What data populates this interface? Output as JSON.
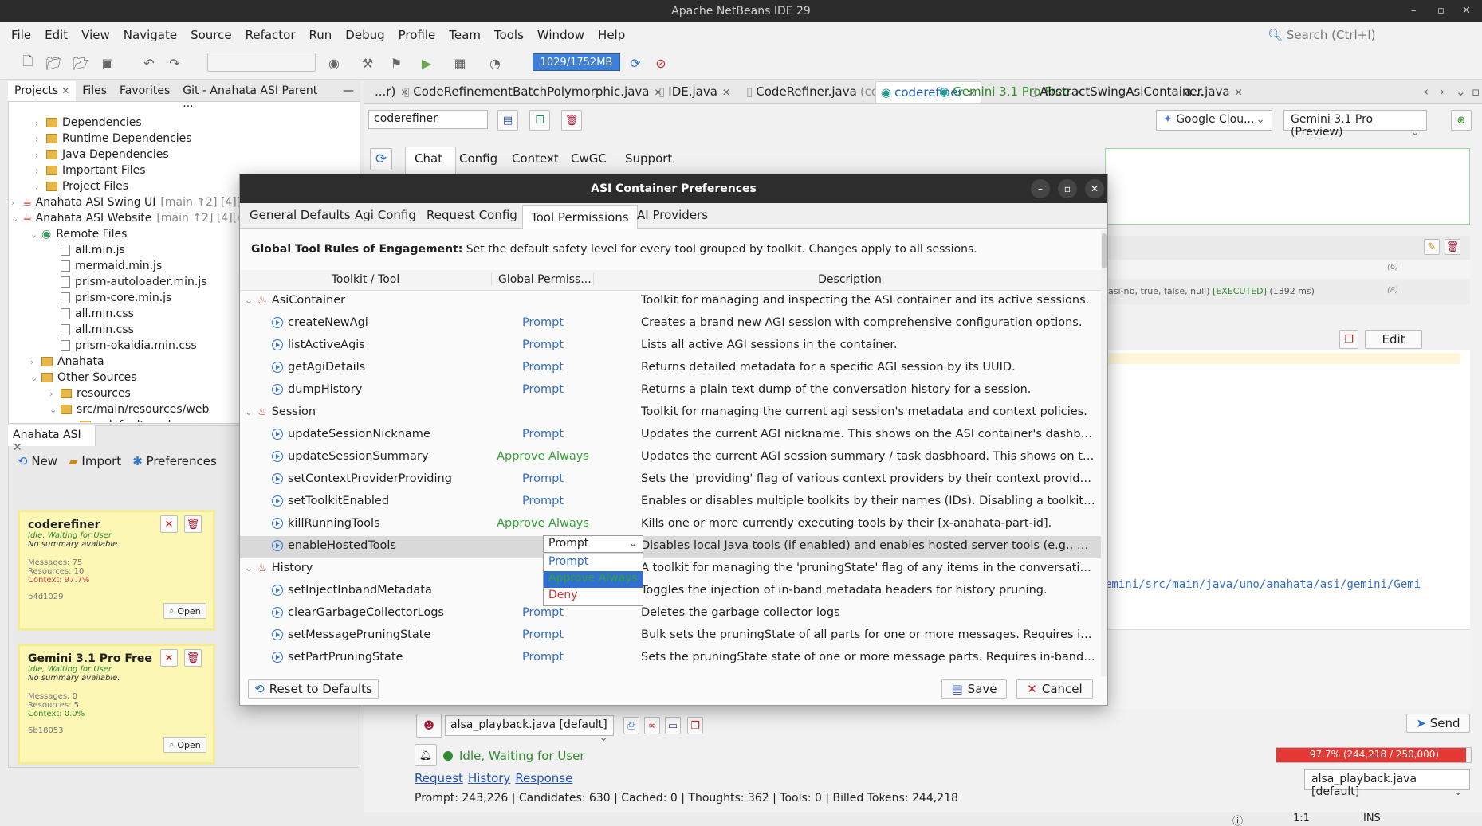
{
  "window": {
    "title": "Apache NetBeans IDE 29"
  },
  "menu": [
    "File",
    "Edit",
    "View",
    "Navigate",
    "Source",
    "Refactor",
    "Run",
    "Debug",
    "Profile",
    "Team",
    "Tools",
    "Window",
    "Help"
  ],
  "search": {
    "placeholder": "Search (Ctrl+I)"
  },
  "toolbar": {
    "memory": "1029/1752MB"
  },
  "left_tabs": [
    "Projects",
    "Files",
    "Favorites",
    "Git - Anahata ASI Parent ..."
  ],
  "tree": [
    {
      "label": "Dependencies"
    },
    {
      "label": "Runtime Dependencies"
    },
    {
      "label": "Java Dependencies"
    },
    {
      "label": "Important Files"
    },
    {
      "label": "Project Files"
    },
    {
      "label": "Anahata ASI Swing UI",
      "meta": "[main ↑2] [4][4]"
    },
    {
      "label": "Anahata ASI Website",
      "meta": "[main ↑2] [4][4]"
    },
    {
      "label": "Remote Files"
    },
    {
      "label": "all.min.js"
    },
    {
      "label": "mermaid.min.js"
    },
    {
      "label": "prism-autoloader.min.js"
    },
    {
      "label": "prism-core.min.js"
    },
    {
      "label": "all.min.css"
    },
    {
      "label": "all.min.css"
    },
    {
      "label": "prism-okaidia.min.css"
    },
    {
      "label": "Anahata"
    },
    {
      "label": "Other Sources"
    },
    {
      "label": "resources"
    },
    {
      "label": "src/main/resources/web"
    },
    {
      "label": "<default package>"
    }
  ],
  "asi_panel": {
    "tab": "Anahata ASI",
    "actions": {
      "new": "New",
      "import": "Import",
      "preferences": "Preferences"
    },
    "cards": [
      {
        "name": "coderefiner",
        "status": "Idle, Waiting for User",
        "summary": "No summary available.",
        "messages": "Messages: 75",
        "resources": "Resources: 10",
        "context": "Context: 97.7%",
        "id": "b4d1029",
        "open": "Open"
      },
      {
        "name": "Gemini 3.1 Pro Free",
        "status": "Idle, Waiting for User",
        "summary": "No summary available.",
        "messages": "Messages: 0",
        "resources": "Resources: 5",
        "context": "Context: 0.0%",
        "id": "6b18053",
        "open": "Open"
      }
    ]
  },
  "editor_tabs": [
    {
      "label": "...r)"
    },
    {
      "label": "CodeRefinementBatchPolymorphic.java"
    },
    {
      "label": "IDE.java"
    },
    {
      "label": "CodeRefiner.java",
      "meta": "(coderefiner)"
    },
    {
      "label": "coderefiner"
    },
    {
      "label": "Gemini 3.1 Pro Free"
    },
    {
      "label": "AbstractSwingAsiContainer.java"
    },
    {
      "label": "a..."
    }
  ],
  "agi_view": {
    "nickname": "coderefiner",
    "provider": "Google Clou...",
    "model": "Gemini 3.1 Pro (Preview)",
    "subtabs": [
      "Chat",
      "Config",
      "Context",
      "CwGC",
      "Support"
    ],
    "edit_button": "Edit",
    "log_line": "asi-nb, true, false, null)",
    "log_status": "[EXECUTED]",
    "log_time": "(1392 ms)",
    "log_counts": [
      "(6)",
      "(8)"
    ],
    "code_path": "emini/src/main/java/uno/anahata/asi/gemini/Gemi",
    "attachment": "alsa_playback.java [default]",
    "send": "Send",
    "status": "Idle, Waiting for User",
    "context_bar": {
      "label": "97.7% (244,218 / 250,000)",
      "fraction": 0.977
    },
    "links": [
      "Request",
      "History",
      "Response"
    ],
    "usage": "Prompt: 243,226 | Candidates: 630 | Cached: 0 | Thoughts: 362 | Tools: 0 | Billed Tokens: 244,218",
    "right_combo": "alsa_playback.java [default]"
  },
  "statusbar": {
    "position": "1:1",
    "mode": "INS"
  },
  "dialog": {
    "title": "ASI Container Preferences",
    "tabs": [
      "General Defaults",
      "Agi Config",
      "Request Config",
      "Tool Permissions",
      "AI Providers"
    ],
    "rules_bold": "Global Tool Rules of Engagement:",
    "rules_text": " Set the default safety level for every tool grouped by toolkit. Changes apply to all sessions.",
    "columns": [
      "Toolkit / Tool",
      "Global Permiss...",
      "Description"
    ],
    "rows": [
      {
        "type": "kit",
        "name": "AsiContainer",
        "perm": "",
        "desc": "Toolkit for managing and inspecting the ASI container and its active sessions."
      },
      {
        "type": "tool",
        "name": "createNewAgi",
        "perm": "Prompt",
        "desc": "Creates a brand new AGI session with comprehensive configuration options."
      },
      {
        "type": "tool",
        "name": "listActiveAgis",
        "perm": "Prompt",
        "desc": "Lists all active AGI sessions in the container."
      },
      {
        "type": "tool",
        "name": "getAgiDetails",
        "perm": "Prompt",
        "desc": "Returns detailed metadata for a specific AGI session by its UUID."
      },
      {
        "type": "tool",
        "name": "dumpHistory",
        "perm": "Prompt",
        "desc": "Returns a plain text dump of the conversation history for a session."
      },
      {
        "type": "kit",
        "name": "Session",
        "perm": "",
        "desc": "Toolkit for managing the current agi session's metadata and context policies."
      },
      {
        "type": "tool",
        "name": "updateSessionNickname",
        "perm": "Prompt",
        "desc": "Updates the current AGI nickname. This shows on the ASI container's dashboard. Only..."
      },
      {
        "type": "tool",
        "name": "updateSessionSummary",
        "perm": "Approve Always",
        "desc": "Updates the current AGI session summary / task dasbhoard. This shows on the ASI co..."
      },
      {
        "type": "tool",
        "name": "setContextProviderProviding",
        "perm": "Prompt",
        "desc": "Sets the 'providing' flag of various context providers by their context provider id. Use thi..."
      },
      {
        "type": "tool",
        "name": "setToolkitEnabled",
        "perm": "Prompt",
        "desc": "Enables or disables multiple toolkits by their names (IDs). Disabling a toolkit, not only r..."
      },
      {
        "type": "tool",
        "name": "killRunningTools",
        "perm": "Approve Always",
        "desc": "Kills one or more currently executing tools by their [x-anahata-part-id]."
      },
      {
        "type": "tool",
        "name": "enableHostedTools",
        "perm": "Prompt",
        "desc": "Disables local Java tools (if enabled) and enables hosted server tools (e.g., Google Se...",
        "selected": true
      },
      {
        "type": "kit",
        "name": "History",
        "perm": "",
        "desc": "A toolkit for managing the 'pruningState' flag of any items in the conversation history."
      },
      {
        "type": "tool",
        "name": "setInjectInbandMetadata",
        "perm": "",
        "desc": "Toggles the injection of in-band metadata headers for history pruning."
      },
      {
        "type": "tool",
        "name": "clearGarbageCollectorLogs",
        "perm": "Prompt",
        "desc": "Deletes the garbage collector logs"
      },
      {
        "type": "tool",
        "name": "setMessagePruningState",
        "perm": "Prompt",
        "desc": "Bulk sets the pruningState of all parts for one or more messages. Requires in-band me..."
      },
      {
        "type": "tool",
        "name": "setPartPruningState",
        "perm": "Prompt",
        "desc": "Sets the pruningState state of one or more message parts. Requires in-band metadata..."
      }
    ],
    "dropdown": {
      "value": "Prompt",
      "options": [
        "Prompt",
        "Approve Always",
        "Deny"
      ]
    },
    "reset_button": "Reset to Defaults",
    "save_button": "Save",
    "cancel_button": "Cancel"
  },
  "colors": {
    "accent": "#2f6fd0",
    "approve": "#34a035",
    "deny": "#d32f2f",
    "context_bar": "#e53935"
  }
}
